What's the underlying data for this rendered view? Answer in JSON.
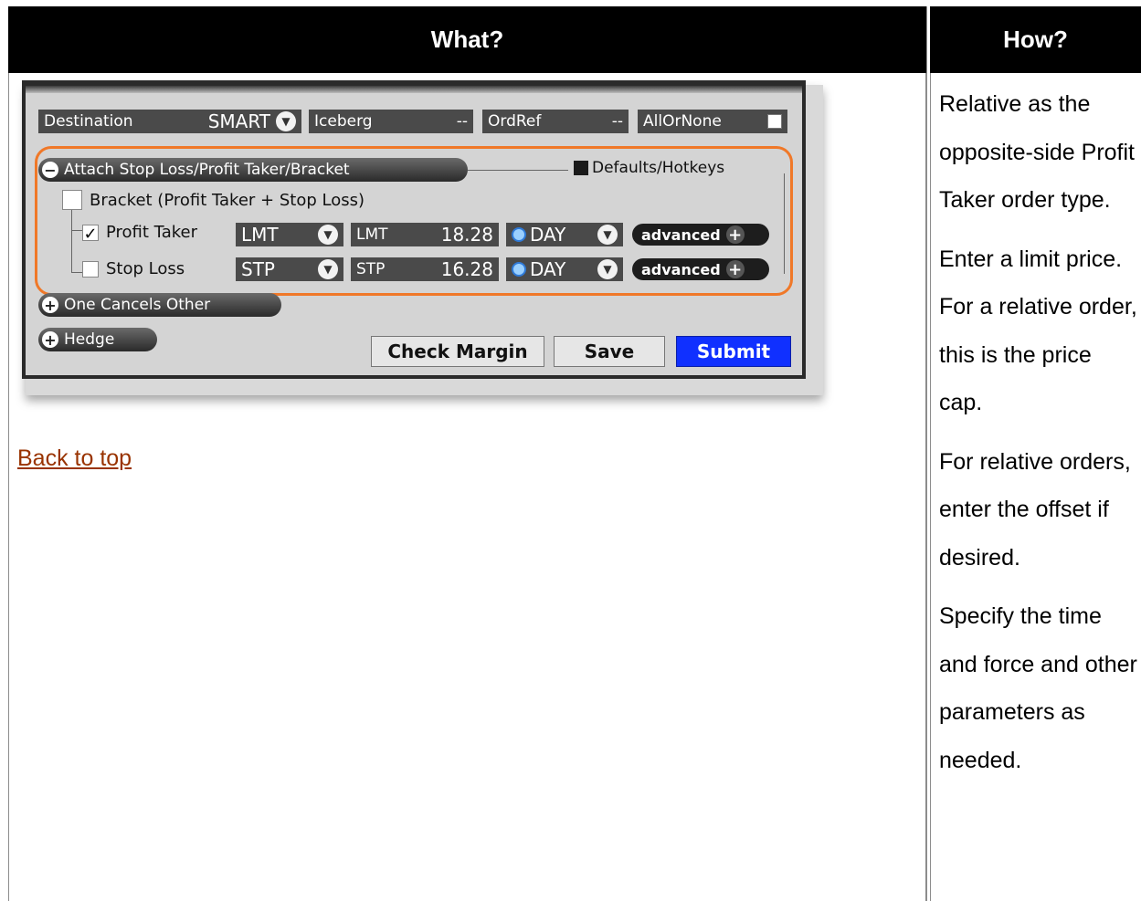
{
  "header": {
    "what": "What?",
    "how": "How?"
  },
  "how_text": [
    "Relative as the opposite-side Profit Taker order type.",
    "Enter a limit price. For a relative order, this is the price cap.",
    "For relative orders, enter the offset if desired.",
    "Specify the time and force and other parameters as needed."
  ],
  "back_to_top": "Back to top",
  "order_panel": {
    "destination": {
      "label": "Destination",
      "value": "SMART"
    },
    "iceberg": {
      "label": "Iceberg",
      "value": "--"
    },
    "ordref": {
      "label": "OrdRef",
      "value": "--"
    },
    "allornone": {
      "label": "AllOrNone"
    },
    "attach_section": "Attach Stop Loss/Profit Taker/Bracket",
    "defaults_hotkeys": "Defaults/Hotkeys",
    "bracket_label": "Bracket (Profit Taker + Stop Loss)",
    "profit_taker": {
      "label": "Profit Taker",
      "checked": true,
      "order_type": "LMT",
      "price_label": "LMT",
      "price": "18.28",
      "tif": "DAY",
      "advanced": "advanced"
    },
    "stop_loss": {
      "label": "Stop Loss",
      "checked": false,
      "order_type": "STP",
      "price_label": "STP",
      "price": "16.28",
      "tif": "DAY",
      "advanced": "advanced"
    },
    "one_cancels_other": "One Cancels Other",
    "hedge": "Hedge",
    "buttons": {
      "check_margin": "Check Margin",
      "save": "Save",
      "submit": "Submit"
    },
    "colors": {
      "highlight": "#f07828",
      "submit": "#1030ff"
    }
  }
}
